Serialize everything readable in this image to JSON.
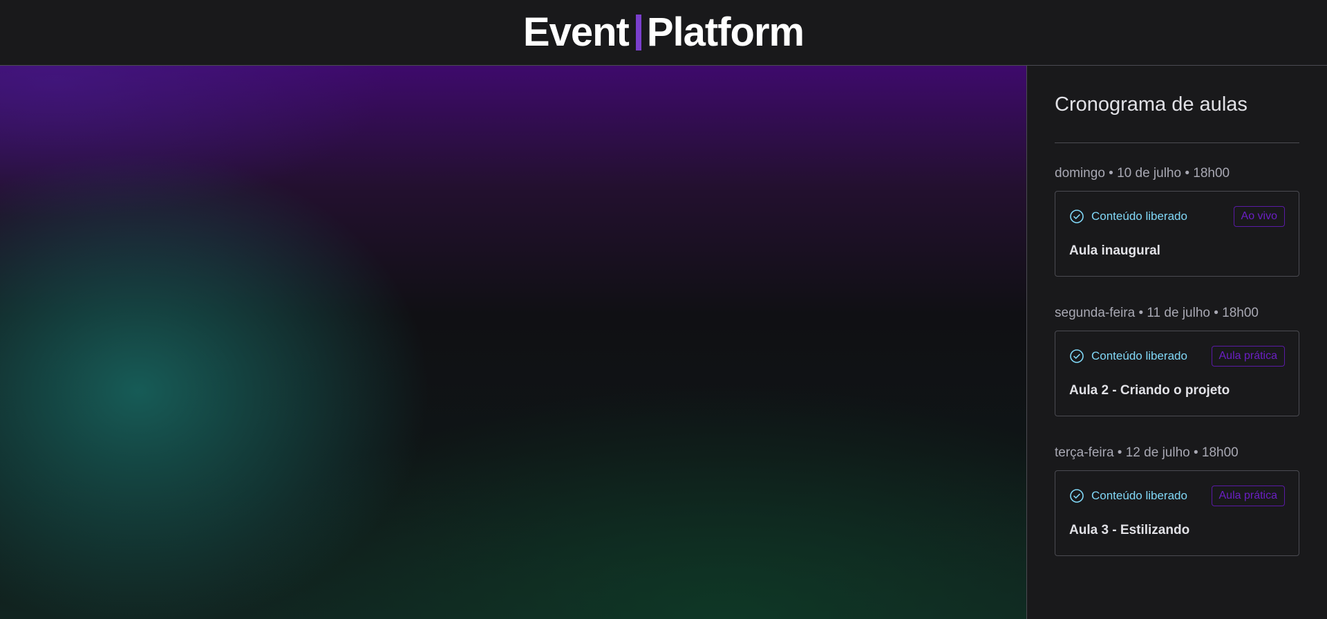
{
  "header": {
    "logo_left": "Event",
    "logo_right": "Platform",
    "accent_color": "#7a3fcc"
  },
  "sidebar": {
    "title": "Cronograma de aulas",
    "lessons": [
      {
        "date": "domingo • 10 de julho • 18h00",
        "status": "Conteúdo liberado",
        "status_icon": "check-circle-icon",
        "badge": "Ao vivo",
        "name": "Aula inaugural"
      },
      {
        "date": "segunda-feira • 11 de julho • 18h00",
        "status": "Conteúdo liberado",
        "status_icon": "check-circle-icon",
        "badge": "Aula prática",
        "name": "Aula 2 - Criando o projeto"
      },
      {
        "date": "terça-feira • 12 de julho • 18h00",
        "status": "Conteúdo liberado",
        "status_icon": "check-circle-icon",
        "badge": "Aula prática",
        "name": "Aula 3 - Estilizando"
      }
    ]
  },
  "colors": {
    "header_bg": "#19191b",
    "status_blue": "#81d8f7",
    "badge_purple": "#6b1fc4",
    "text_light": "#e1e1e6"
  }
}
